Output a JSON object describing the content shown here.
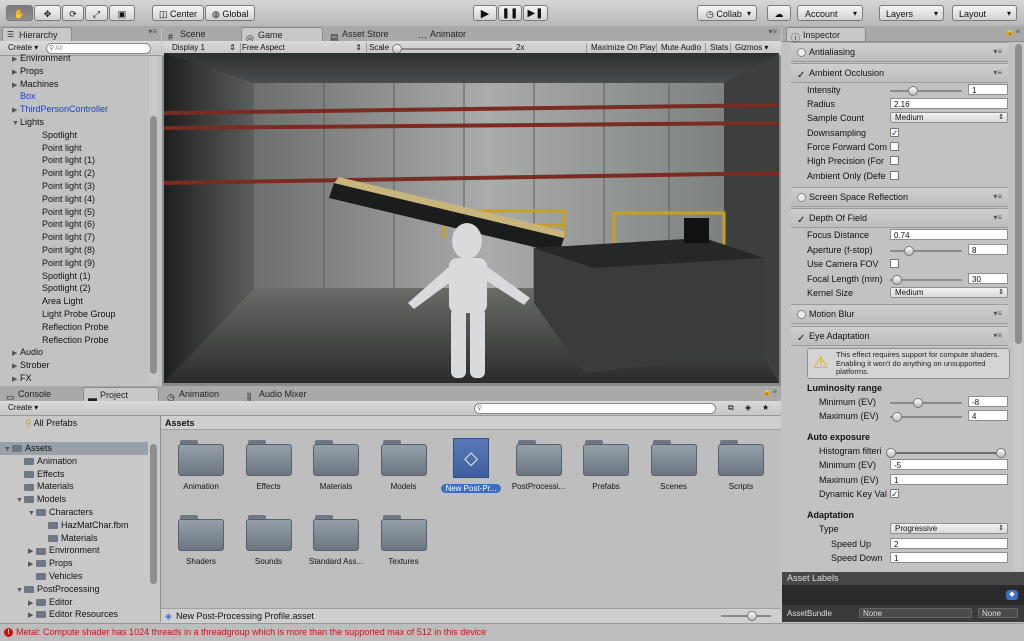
{
  "toolbar": {
    "center_label": "Center",
    "global_label": "Global",
    "collab_label": "Collab",
    "account_label": "Account",
    "layers_label": "Layers",
    "layout_label": "Layout",
    "icons": [
      "hand-icon",
      "move-icon",
      "rotate-icon",
      "scale-icon",
      "rect-icon",
      "play-icon",
      "pause-icon",
      "step-icon",
      "cloud-icon"
    ]
  },
  "hierarchy": {
    "tab": "Hierarchy",
    "create": "Create",
    "search_placeholder": "All",
    "items": [
      {
        "label": "Environment",
        "depth": 0,
        "arrow": "right"
      },
      {
        "label": "Props",
        "depth": 0,
        "arrow": "right"
      },
      {
        "label": "Machines",
        "depth": 0,
        "arrow": "right"
      },
      {
        "label": "Box",
        "depth": 0,
        "arrow": "",
        "blue": true
      },
      {
        "label": "ThirdPersonController",
        "depth": 0,
        "arrow": "right",
        "blue": true
      },
      {
        "label": "Lights",
        "depth": 0,
        "arrow": "down"
      },
      {
        "label": "Spotlight",
        "depth": 1,
        "arrow": ""
      },
      {
        "label": "Point light",
        "depth": 1,
        "arrow": ""
      },
      {
        "label": "Point light (1)",
        "depth": 1,
        "arrow": ""
      },
      {
        "label": "Point light (2)",
        "depth": 1,
        "arrow": ""
      },
      {
        "label": "Point light (3)",
        "depth": 1,
        "arrow": ""
      },
      {
        "label": "Point light (4)",
        "depth": 1,
        "arrow": ""
      },
      {
        "label": "Point light (5)",
        "depth": 1,
        "arrow": ""
      },
      {
        "label": "Point light (6)",
        "depth": 1,
        "arrow": ""
      },
      {
        "label": "Point light (7)",
        "depth": 1,
        "arrow": ""
      },
      {
        "label": "Point light (8)",
        "depth": 1,
        "arrow": ""
      },
      {
        "label": "Point light (9)",
        "depth": 1,
        "arrow": ""
      },
      {
        "label": "Spotlight (1)",
        "depth": 1,
        "arrow": ""
      },
      {
        "label": "Spotlight (2)",
        "depth": 1,
        "arrow": ""
      },
      {
        "label": "Area Light",
        "depth": 1,
        "arrow": ""
      },
      {
        "label": "Light Probe Group",
        "depth": 1,
        "arrow": ""
      },
      {
        "label": "Reflection Probe",
        "depth": 1,
        "arrow": ""
      },
      {
        "label": "Reflection Probe",
        "depth": 1,
        "arrow": ""
      },
      {
        "label": "Audio",
        "depth": 0,
        "arrow": "right"
      },
      {
        "label": "Strober",
        "depth": 0,
        "arrow": "right"
      },
      {
        "label": "FX",
        "depth": 0,
        "arrow": "right"
      }
    ]
  },
  "center_tabs": {
    "scene": "Scene",
    "game": "Game",
    "asset_store": "Asset Store",
    "animator": "Animator"
  },
  "game_bar": {
    "display": "Display 1",
    "aspect": "Free Aspect",
    "scale_label": "Scale",
    "scale_value": "2x",
    "maximize": "Maximize On Play",
    "mute": "Mute Audio",
    "stats": "Stats",
    "gizmos": "Gizmos"
  },
  "bottom_tabs": {
    "console": "Console",
    "project": "Project",
    "animation": "Animation",
    "audio_mixer": "Audio Mixer"
  },
  "project": {
    "create": "Create",
    "favorites": "All Prefabs",
    "tree": [
      {
        "label": "Assets",
        "depth": 0,
        "arrow": "down",
        "selected": true
      },
      {
        "label": "Animation",
        "depth": 1,
        "arrow": ""
      },
      {
        "label": "Effects",
        "depth": 1,
        "arrow": ""
      },
      {
        "label": "Materials",
        "depth": 1,
        "arrow": ""
      },
      {
        "label": "Models",
        "depth": 1,
        "arrow": "down"
      },
      {
        "label": "Characters",
        "depth": 2,
        "arrow": "down"
      },
      {
        "label": "HazMatChar.fbm",
        "depth": 3,
        "arrow": ""
      },
      {
        "label": "Materials",
        "depth": 3,
        "arrow": ""
      },
      {
        "label": "Environment",
        "depth": 2,
        "arrow": "right"
      },
      {
        "label": "Props",
        "depth": 2,
        "arrow": "right"
      },
      {
        "label": "Vehicles",
        "depth": 2,
        "arrow": ""
      },
      {
        "label": "PostProcessing",
        "depth": 1,
        "arrow": "down"
      },
      {
        "label": "Editor",
        "depth": 2,
        "arrow": "right"
      },
      {
        "label": "Editor Resources",
        "depth": 2,
        "arrow": "right"
      }
    ],
    "breadcrumb": "Assets",
    "assets": [
      {
        "label": "Animation",
        "type": "folder"
      },
      {
        "label": "Effects",
        "type": "folder"
      },
      {
        "label": "Materials",
        "type": "folder"
      },
      {
        "label": "Models",
        "type": "folder"
      },
      {
        "label": "New Post-Pr...",
        "type": "profile",
        "selected": true
      },
      {
        "label": "PostProcessi...",
        "type": "folder"
      },
      {
        "label": "Prefabs",
        "type": "folder"
      },
      {
        "label": "Scenes",
        "type": "folder"
      },
      {
        "label": "Scripts",
        "type": "folder"
      },
      {
        "label": "Shaders",
        "type": "folder"
      },
      {
        "label": "Sounds",
        "type": "folder"
      },
      {
        "label": "Standard Ass...",
        "type": "folder"
      },
      {
        "label": "Textures",
        "type": "folder"
      }
    ],
    "selected_path": "New Post-Processing Profile.asset",
    "filter_count": "2"
  },
  "inspector": {
    "tab": "Inspector",
    "antialiasing": "Antialiasing",
    "ambient_occlusion": "Ambient Occlusion",
    "ao": {
      "intensity_label": "Intensity",
      "intensity_value": "1",
      "intensity_fraction": 0.3,
      "radius_label": "Radius",
      "radius_value": "2.16",
      "sample_count_label": "Sample Count",
      "sample_count_value": "Medium",
      "downsampling_label": "Downsampling",
      "downsampling_checked": true,
      "force_forward_label": "Force Forward Com",
      "force_forward_checked": false,
      "high_precision_label": "High Precision (For",
      "high_precision_checked": false,
      "ambient_only_label": "Ambient Only (Defe",
      "ambient_only_checked": false
    },
    "ssr": "Screen Space Reflection",
    "dof_title": "Depth Of Field",
    "dof": {
      "focus_label": "Focus Distance",
      "focus_value": "0.74",
      "aperture_label": "Aperture (f-stop)",
      "aperture_value": "8",
      "aperture_fraction": 0.25,
      "camera_fov_label": "Use Camera FOV",
      "camera_fov_checked": false,
      "focal_label": "Focal Length (mm)",
      "focal_value": "30",
      "focal_fraction": 0.08,
      "kernel_label": "Kernel Size",
      "kernel_value": "Medium"
    },
    "motion_blur": "Motion Blur",
    "eye_adaptation": "Eye Adaptation",
    "ea": {
      "warning": "This effect requires support for compute shaders. Enabling it won't do anything on unsupported platforms.",
      "luminosity_header": "Luminosity range",
      "min_label": "Minimum (EV)",
      "min_value": "-8",
      "min_fraction": 0.38,
      "max_label": "Maximum (EV)",
      "max_value": "4",
      "max_fraction": 0.08,
      "auto_header": "Auto exposure",
      "hist_label": "Histogram filteri",
      "hist_low_fraction": 0.0,
      "hist_high_fraction": 0.95,
      "auto_min_label": "Minimum (EV)",
      "auto_min_value": "-5",
      "auto_max_label": "Maximum (EV)",
      "auto_max_value": "1",
      "dynamic_label": "Dynamic Key Val",
      "dynamic_checked": true,
      "adaptation_header": "Adaptation",
      "type_label": "Type",
      "type_value": "Progressive",
      "speed_up_label": "Speed Up",
      "speed_up_value": "2",
      "speed_down_label": "Speed Down",
      "speed_down_value": "1"
    },
    "asset_labels": "Asset Labels",
    "asset_bundle_label": "AssetBundle",
    "asset_bundle_value": "None",
    "asset_bundle_variant": "None"
  },
  "status": {
    "message": "Metal: Compute shader has 1024 threads in a threadgroup which is more than the supported max of 512 in this device",
    "error_color": "#cc1111"
  },
  "colors": {
    "panel": "#c2c2c2",
    "selection": "#3d6ec5",
    "error": "#cc1111"
  }
}
